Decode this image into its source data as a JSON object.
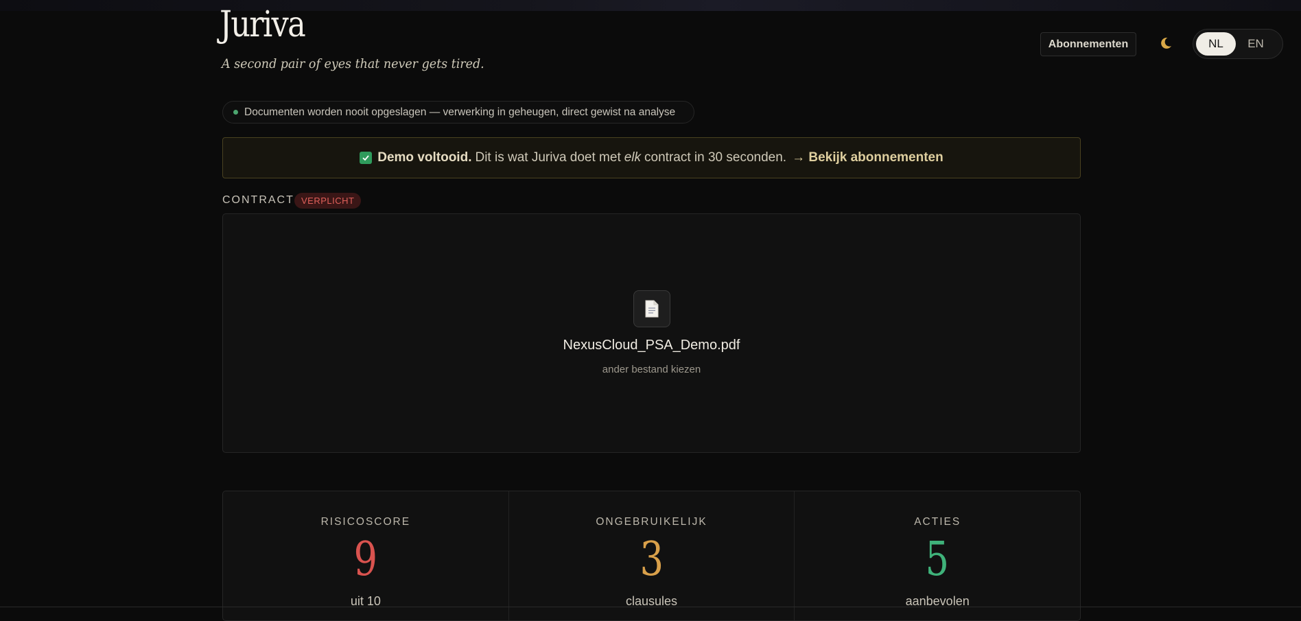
{
  "app": {
    "title": "Juriva",
    "tagline": "A second pair of eyes that never gets tired."
  },
  "nav": {
    "subscriptions_label": "Abonnementen",
    "theme_icon": "moon-icon",
    "languages": [
      "NL",
      "EN"
    ],
    "active_language": "NL"
  },
  "privacy_notice": "Documenten worden nooit opgeslagen — verwerking in geheugen, direct gewist na analyse",
  "demo_banner": {
    "strong": "Demo voltooid.",
    "text_before": "Dit is wat Juriva doet met",
    "text_em": "elk",
    "text_after": "contract in 30 seconden.",
    "link": "→ Bekijk abonnementen"
  },
  "contract": {
    "label": "CONTRACT",
    "required_badge": "VERPLICHT",
    "file_name": "NexusCloud_PSA_Demo.pdf",
    "choose_other": "ander bestand kiezen"
  },
  "stats": [
    {
      "label": "RISICOSCORE",
      "value": "9",
      "unit": "uit 10",
      "color": "#d9534f"
    },
    {
      "label": "ONGEBRUIKELIJK",
      "value": "3",
      "unit": "clausules",
      "color": "#d9a04a"
    },
    {
      "label": "ACTIES",
      "value": "5",
      "unit": "aanbevolen",
      "color": "#3fb27a"
    }
  ],
  "colors": {
    "background": "#0b0b0b",
    "accent_gold": "#dfcf9f",
    "success": "#2f9b5c",
    "danger": "#e0605a"
  }
}
